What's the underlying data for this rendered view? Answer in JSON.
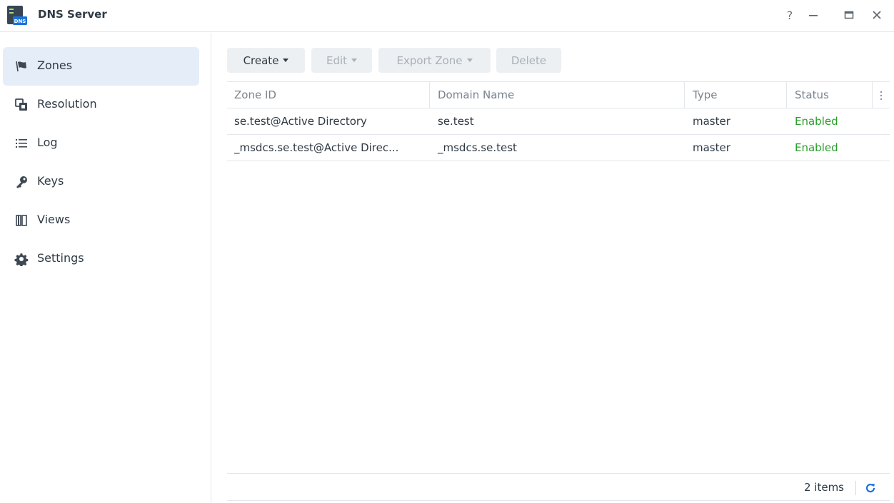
{
  "window": {
    "title": "DNS Server",
    "app_icon_text": "DNS",
    "controls": {
      "help": "?",
      "minimize": "minimize",
      "maximize": "maximize",
      "close": "close"
    }
  },
  "sidebar": {
    "items": [
      {
        "label": "Zones",
        "icon": "flag-icon",
        "active": true
      },
      {
        "label": "Resolution",
        "icon": "resolution-icon",
        "active": false
      },
      {
        "label": "Log",
        "icon": "list-icon",
        "active": false
      },
      {
        "label": "Keys",
        "icon": "key-icon",
        "active": false
      },
      {
        "label": "Views",
        "icon": "book-icon",
        "active": false
      },
      {
        "label": "Settings",
        "icon": "gear-icon",
        "active": false
      }
    ]
  },
  "toolbar": {
    "create": "Create",
    "edit": "Edit",
    "export_zone": "Export Zone",
    "delete": "Delete"
  },
  "table": {
    "columns": [
      "Zone ID",
      "Domain Name",
      "Type",
      "Status"
    ],
    "rows": [
      {
        "zone_id": "se.test@Active Directory",
        "domain": "se.test",
        "type": "master",
        "status": "Enabled"
      },
      {
        "zone_id": "_msdcs.se.test@Active Direc...",
        "domain": "_msdcs.se.test",
        "type": "master",
        "status": "Enabled"
      }
    ]
  },
  "footer": {
    "count": "2 items"
  },
  "colors": {
    "accent": "#1a73d9",
    "enabled": "#2a9d2a",
    "active_bg": "#e4edf8"
  }
}
